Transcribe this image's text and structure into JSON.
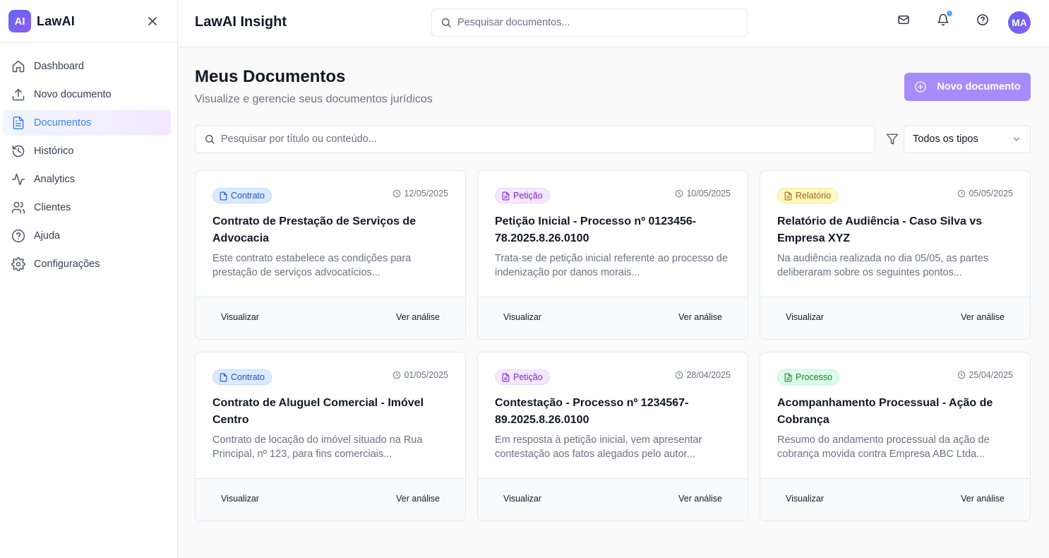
{
  "sidebar": {
    "logo_text": "AI",
    "brand": "LawAI",
    "items": [
      {
        "label": "Dashboard",
        "icon": "home-icon"
      },
      {
        "label": "Novo documento",
        "icon": "upload-icon"
      },
      {
        "label": "Documentos",
        "icon": "document-icon",
        "active": true
      },
      {
        "label": "Histórico",
        "icon": "history-icon"
      },
      {
        "label": "Analytics",
        "icon": "activity-icon"
      },
      {
        "label": "Clientes",
        "icon": "users-icon"
      },
      {
        "label": "Ajuda",
        "icon": "help-circle-icon"
      },
      {
        "label": "Configurações",
        "icon": "gear-icon"
      }
    ]
  },
  "header": {
    "title": "LawAI Insight",
    "search_placeholder": "Pesquisar documentos...",
    "avatar_initials": "MA"
  },
  "main": {
    "title": "Meus Documentos",
    "subtitle": "Visualize e gerencie seus documentos jurídicos",
    "new_button": "Novo documento",
    "search_placeholder": "Pesquisar por título ou conteúdo...",
    "type_filter": "Todos os tipos"
  },
  "colors": {
    "accent": "#a78bfa",
    "contrato": "#1d4ed8",
    "peticao": "#7e22ce",
    "relatorio": "#a16207",
    "processo": "#15803d"
  },
  "documents": [
    {
      "type": "Contrato",
      "date": "12/05/2025",
      "title": "Contrato de Prestação de Serviços de Advocacia",
      "description": "Este contrato estabelece as condições para prestação de serviços advocatícios...",
      "view": "Visualizar",
      "analysis": "Ver análise"
    },
    {
      "type": "Petição",
      "date": "10/05/2025",
      "title": "Petição Inicial - Processo nº 0123456-78.2025.8.26.0100",
      "description": "Trata-se de petição inicial referente ao processo de indenização por danos morais...",
      "view": "Visualizar",
      "analysis": "Ver análise"
    },
    {
      "type": "Relatório",
      "date": "05/05/2025",
      "title": "Relatório de Audiência - Caso Silva vs Empresa XYZ",
      "description": "Na audiência realizada no dia 05/05, as partes deliberaram sobre os seguintes pontos...",
      "view": "Visualizar",
      "analysis": "Ver análise"
    },
    {
      "type": "Contrato",
      "date": "01/05/2025",
      "title": "Contrato de Aluguel Comercial - Imóvel Centro",
      "description": "Contrato de locação do imóvel situado na Rua Principal, nº 123, para fins comerciais...",
      "view": "Visualizar",
      "analysis": "Ver análise"
    },
    {
      "type": "Petição",
      "date": "28/04/2025",
      "title": "Contestação - Processo nº 1234567-89.2025.8.26.0100",
      "description": "Em resposta à petição inicial, vem apresentar contestação aos fatos alegados pelo autor...",
      "view": "Visualizar",
      "analysis": "Ver análise"
    },
    {
      "type": "Processo",
      "date": "25/04/2025",
      "title": "Acompanhamento Processual - Ação de Cobrança",
      "description": "Resumo do andamento processual da ação de cobrança movida contra Empresa ABC Ltda...",
      "view": "Visualizar",
      "analysis": "Ver análise"
    }
  ]
}
